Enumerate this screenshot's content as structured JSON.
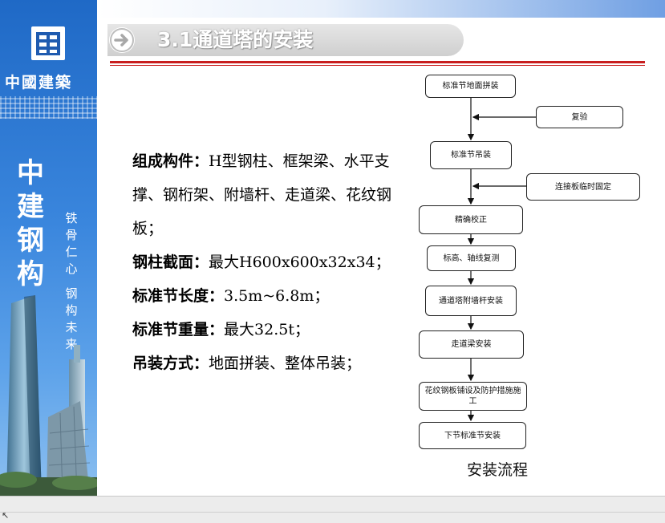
{
  "sidebar": {
    "company_name": "中國建築",
    "brand_vertical": "中建钢构",
    "slogan_1": "铁骨仁心",
    "slogan_2": "钢构未来"
  },
  "header": {
    "title": "3.1通道塔的安装"
  },
  "content": {
    "lines": [
      {
        "label": "组成构件：",
        "text": "H型钢柱、框架梁、水平支撑、钢桁架、附墙杆、走道梁、花纹钢板；"
      },
      {
        "label": "钢柱截面：",
        "text": "最大H600x600x32x34；"
      },
      {
        "label": "标准节长度：",
        "text": "3.5m~6.8m；"
      },
      {
        "label": "标准节重量：",
        "text": "最大32.5t；"
      },
      {
        "label": "吊装方式：",
        "text": "地面拼装、整体吊装；"
      }
    ]
  },
  "flowchart": {
    "caption": "安装流程",
    "main_steps": [
      "标准节地面拼装",
      "标准节吊装",
      "精确校正",
      "标高、轴线复测",
      "通道塔附墙杆安装",
      "走道梁安装",
      "花纹钢板铺设及防护措施施工",
      "下节标准节安装"
    ],
    "side_inputs": [
      "复验",
      "连接板临时固定"
    ]
  },
  "colors": {
    "sidebar_blue": "#1f69c6",
    "accent_red": "#c81e1e",
    "title_gray": "#cfcfcf"
  }
}
